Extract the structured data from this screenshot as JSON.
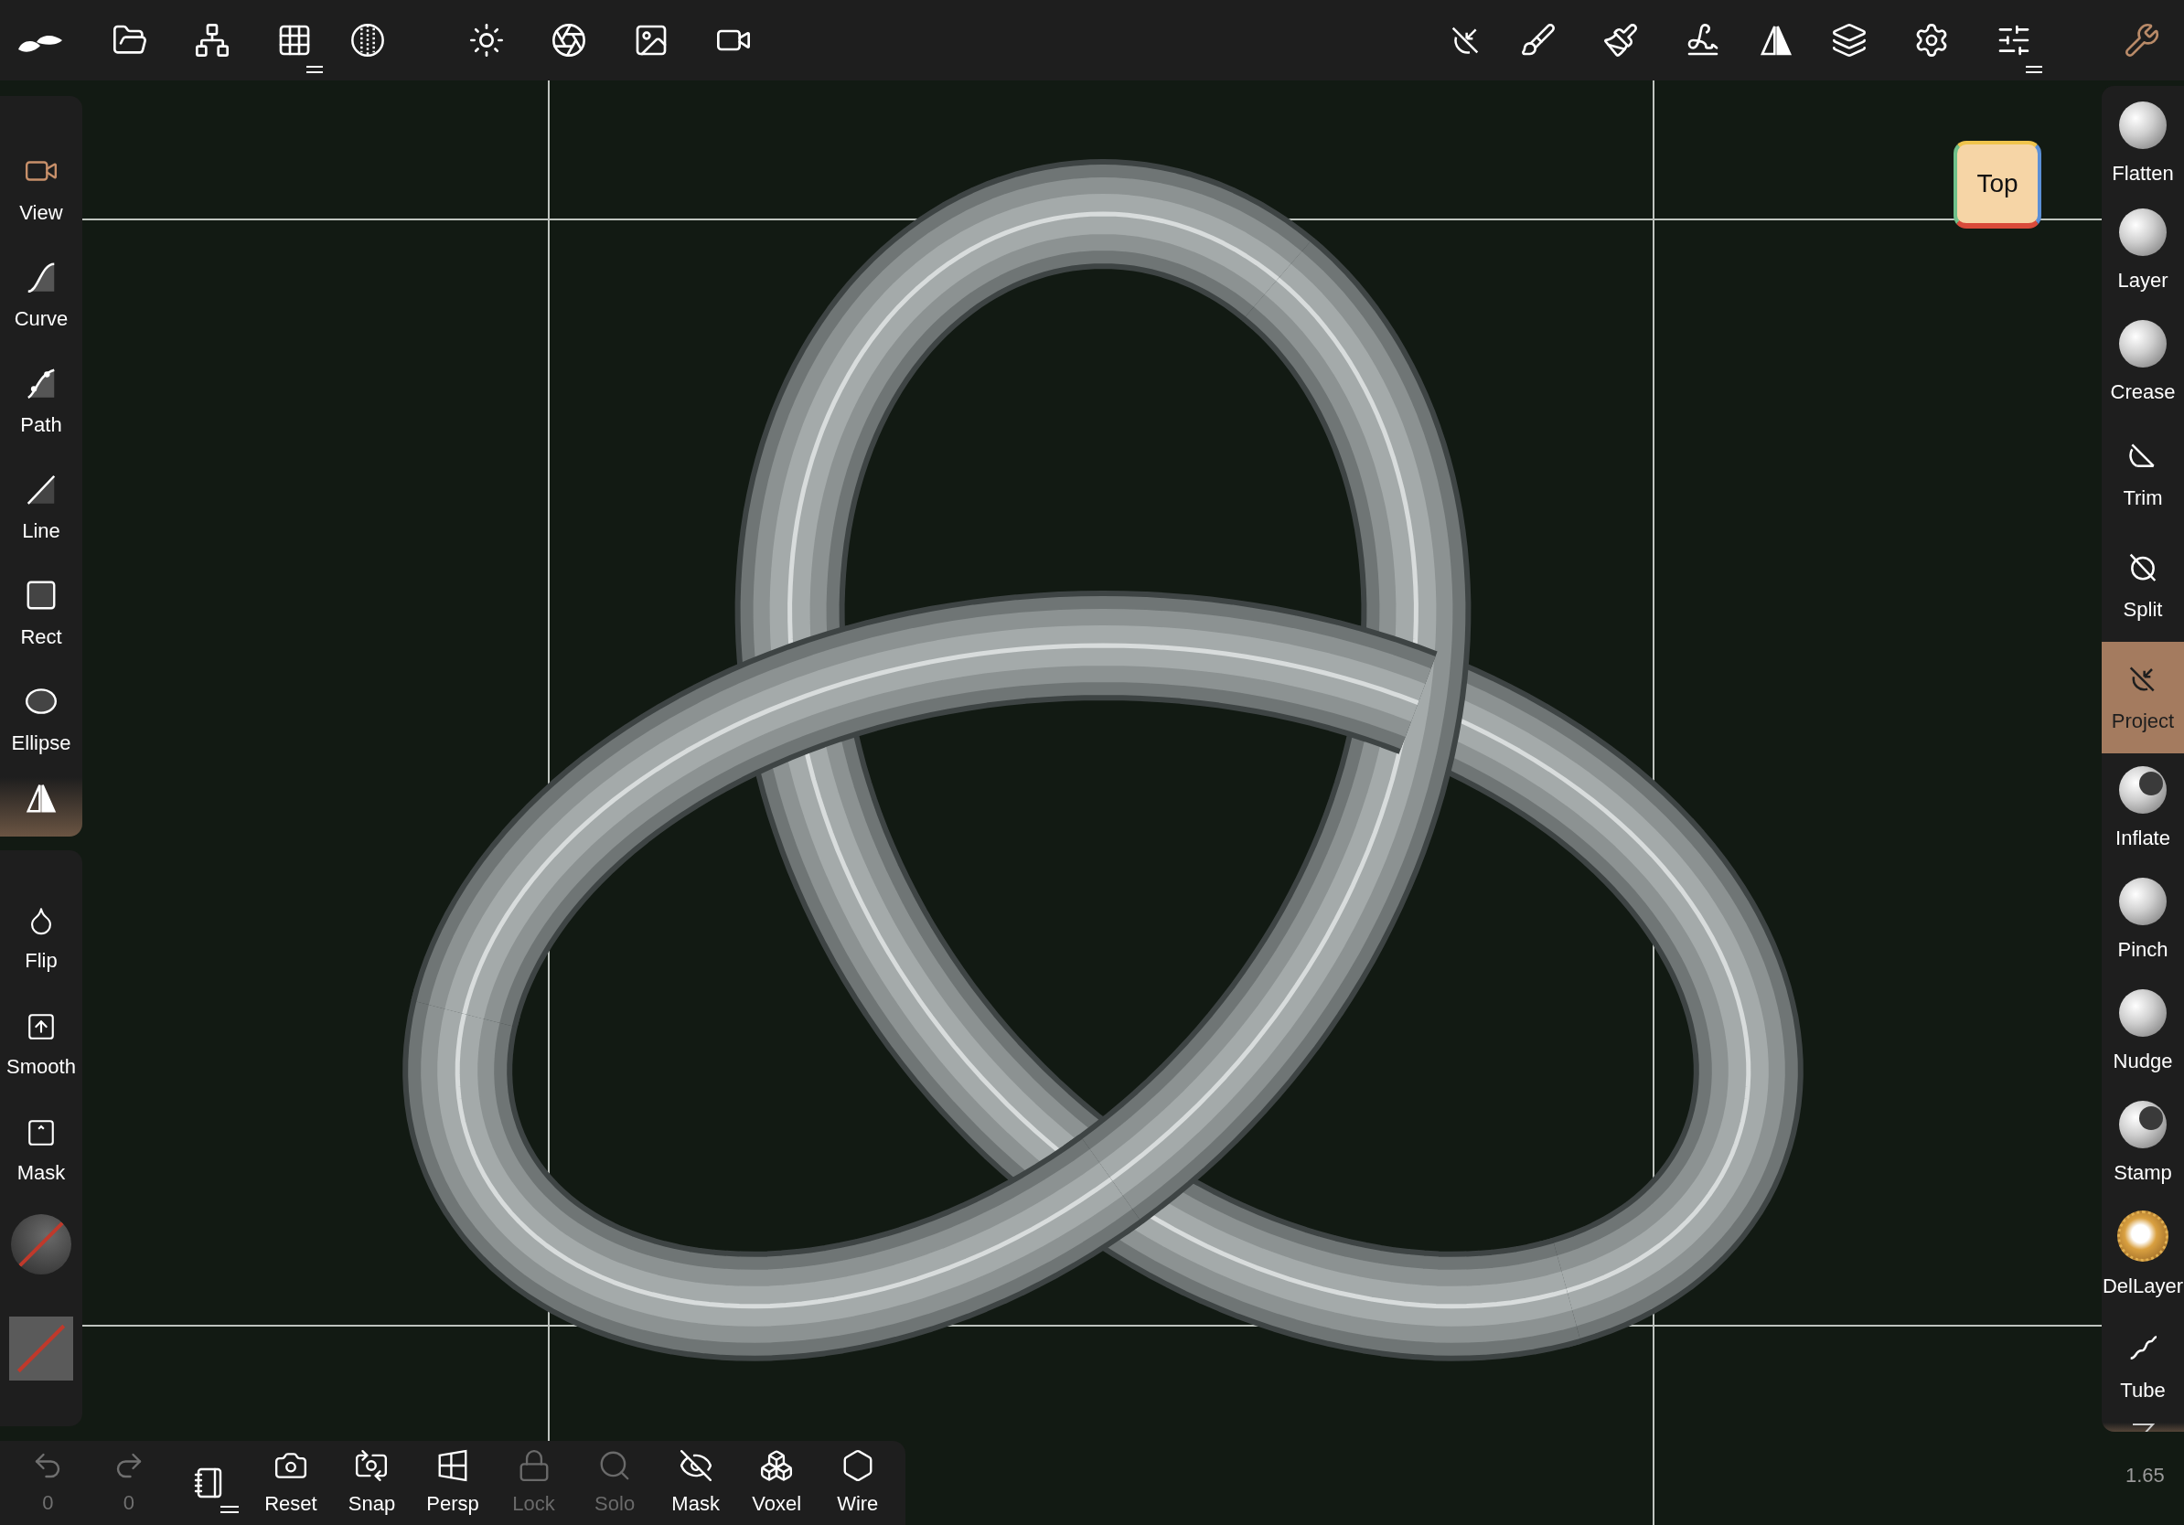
{
  "view_cube": {
    "label": "Top"
  },
  "left_tools": [
    {
      "label": "View",
      "selected": true
    },
    {
      "label": "Curve",
      "selected": false
    },
    {
      "label": "Path",
      "selected": false
    },
    {
      "label": "Line",
      "selected": false
    },
    {
      "label": "Rect",
      "selected": false
    },
    {
      "label": "Ellipse",
      "selected": false
    }
  ],
  "left_actions": [
    {
      "label": "Flip"
    },
    {
      "label": "Smooth"
    },
    {
      "label": "Mask"
    }
  ],
  "right_brushes": [
    {
      "label": "Flatten",
      "selected": false
    },
    {
      "label": "Layer",
      "selected": false
    },
    {
      "label": "Crease",
      "selected": false
    },
    {
      "label": "Trim",
      "selected": false
    },
    {
      "label": "Split",
      "selected": false
    },
    {
      "label": "Project",
      "selected": true
    },
    {
      "label": "Inflate",
      "selected": false
    },
    {
      "label": "Pinch",
      "selected": false
    },
    {
      "label": "Nudge",
      "selected": false
    },
    {
      "label": "Stamp",
      "selected": false
    },
    {
      "label": "DelLayer",
      "selected": false
    },
    {
      "label": "Tube",
      "selected": false
    }
  ],
  "bottom_toolbar": {
    "undo": {
      "count": "0",
      "disabled": true
    },
    "redo": {
      "count": "0",
      "disabled": true
    },
    "buttons": [
      {
        "label": "Reset",
        "disabled": false
      },
      {
        "label": "Snap",
        "disabled": false
      },
      {
        "label": "Persp",
        "disabled": false
      },
      {
        "label": "Lock",
        "disabled": true
      },
      {
        "label": "Solo",
        "disabled": true
      },
      {
        "label": "Mask",
        "disabled": false
      },
      {
        "label": "Voxel",
        "disabled": false
      },
      {
        "label": "Wire",
        "disabled": false
      }
    ]
  },
  "zoom_level": "1.65"
}
